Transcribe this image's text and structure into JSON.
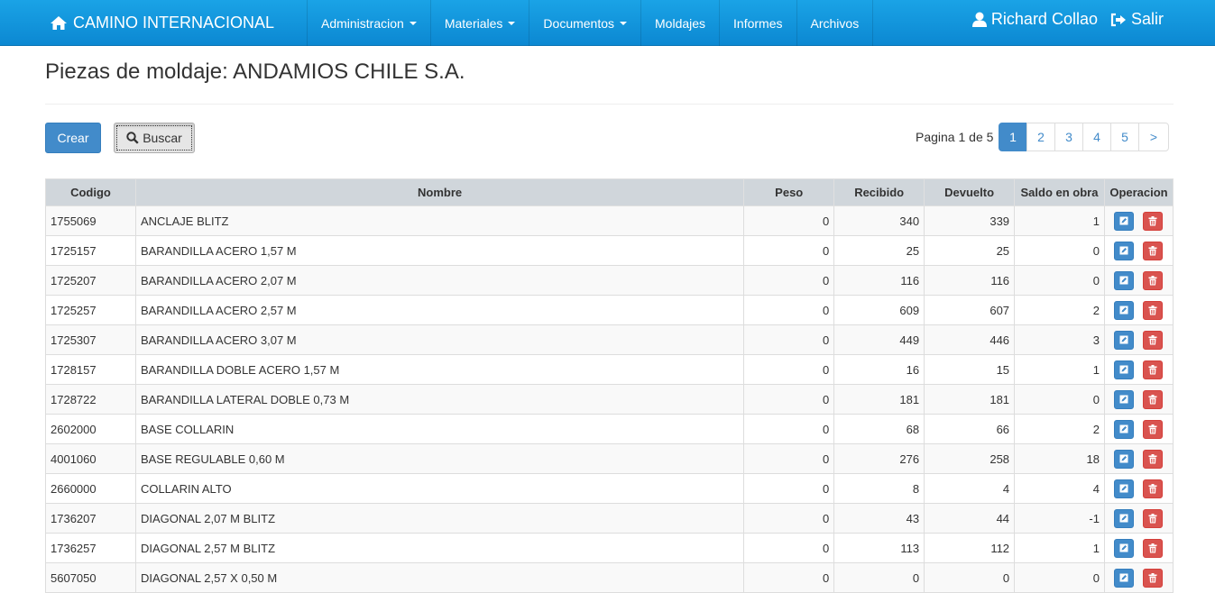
{
  "navbar": {
    "brand": "CAMINO INTERNACIONAL",
    "brand_icon": "home-icon",
    "menu": [
      {
        "label": "Administracion",
        "dropdown": true
      },
      {
        "label": "Materiales",
        "dropdown": true
      },
      {
        "label": "Documentos",
        "dropdown": true
      },
      {
        "label": "Moldajes",
        "dropdown": false
      },
      {
        "label": "Informes",
        "dropdown": false
      },
      {
        "label": "Archivos",
        "dropdown": false
      }
    ],
    "user": "Richard Collao",
    "logout": "Salir"
  },
  "page": {
    "title": "Piezas de moldaje: ANDAMIOS CHILE S.A.",
    "create_label": "Crear",
    "search_label": "Buscar",
    "page_info": "Pagina 1 de 5"
  },
  "pagination": {
    "pages": [
      "1",
      "2",
      "3",
      "4",
      "5",
      ">"
    ],
    "active": "1"
  },
  "table": {
    "headers": [
      "Codigo",
      "Nombre",
      "Peso",
      "Recibido",
      "Devuelto",
      "Saldo en obra",
      "Operacion"
    ],
    "rows": [
      [
        "1755069",
        "ANCLAJE BLITZ",
        "0",
        "340",
        "339",
        "1"
      ],
      [
        "1725157",
        "BARANDILLA ACERO 1,57 M",
        "0",
        "25",
        "25",
        "0"
      ],
      [
        "1725207",
        "BARANDILLA ACERO 2,07 M",
        "0",
        "116",
        "116",
        "0"
      ],
      [
        "1725257",
        "BARANDILLA ACERO 2,57 M",
        "0",
        "609",
        "607",
        "2"
      ],
      [
        "1725307",
        "BARANDILLA ACERO 3,07 M",
        "0",
        "449",
        "446",
        "3"
      ],
      [
        "1728157",
        "BARANDILLA DOBLE ACERO 1,57 M",
        "0",
        "16",
        "15",
        "1"
      ],
      [
        "1728722",
        "BARANDILLA LATERAL DOBLE 0,73 M",
        "0",
        "181",
        "181",
        "0"
      ],
      [
        "2602000",
        "BASE COLLARIN",
        "0",
        "68",
        "66",
        "2"
      ],
      [
        "4001060",
        "BASE REGULABLE 0,60 M",
        "0",
        "276",
        "258",
        "18"
      ],
      [
        "2660000",
        "COLLARIN ALTO",
        "0",
        "8",
        "4",
        "4"
      ],
      [
        "1736207",
        "DIAGONAL 2,07 M BLITZ",
        "0",
        "43",
        "44",
        "-1"
      ],
      [
        "1736257",
        "DIAGONAL 2,57 M BLITZ",
        "0",
        "113",
        "112",
        "1"
      ],
      [
        "5607050",
        "DIAGONAL 2,57 X 0,50 M",
        "0",
        "0",
        "0",
        "0"
      ]
    ]
  },
  "colors": {
    "navbar": "#1aa3e6",
    "primary": "#428bca",
    "danger": "#d9534f"
  }
}
